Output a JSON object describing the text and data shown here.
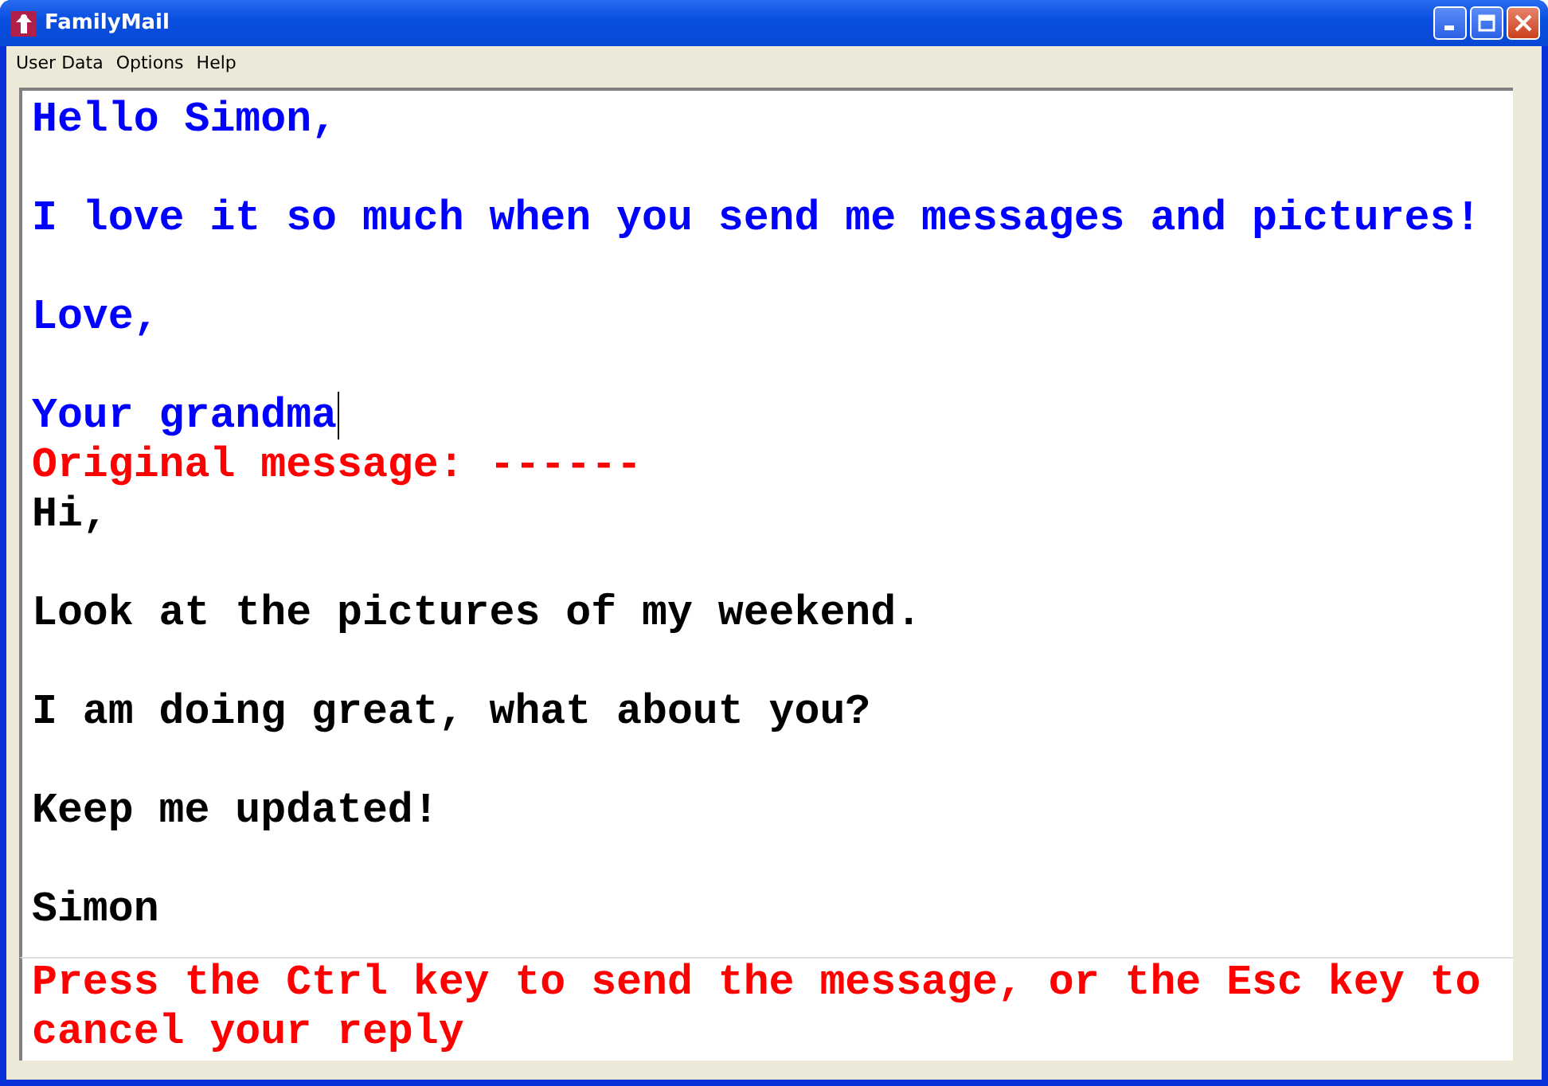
{
  "window": {
    "title": "FamilyMail"
  },
  "menu": [
    "User Data",
    "Options",
    "Help"
  ],
  "reply": [
    {
      "text": "Hello Simon,",
      "caret": false
    },
    {
      "text": "I love it so much when you send me messages and pictures!",
      "caret": false
    },
    {
      "text": "Love,",
      "caret": false
    },
    {
      "text": "Your grandma",
      "caret": true
    }
  ],
  "original_header": "Original message: ------",
  "original": [
    "Hi,",
    "Look at the pictures of my weekend.",
    "I am doing great, what about you?",
    "Keep me updated!",
    "Simon"
  ],
  "hint": "Press the Ctrl key to send the message, or the Esc key to cancel your reply"
}
